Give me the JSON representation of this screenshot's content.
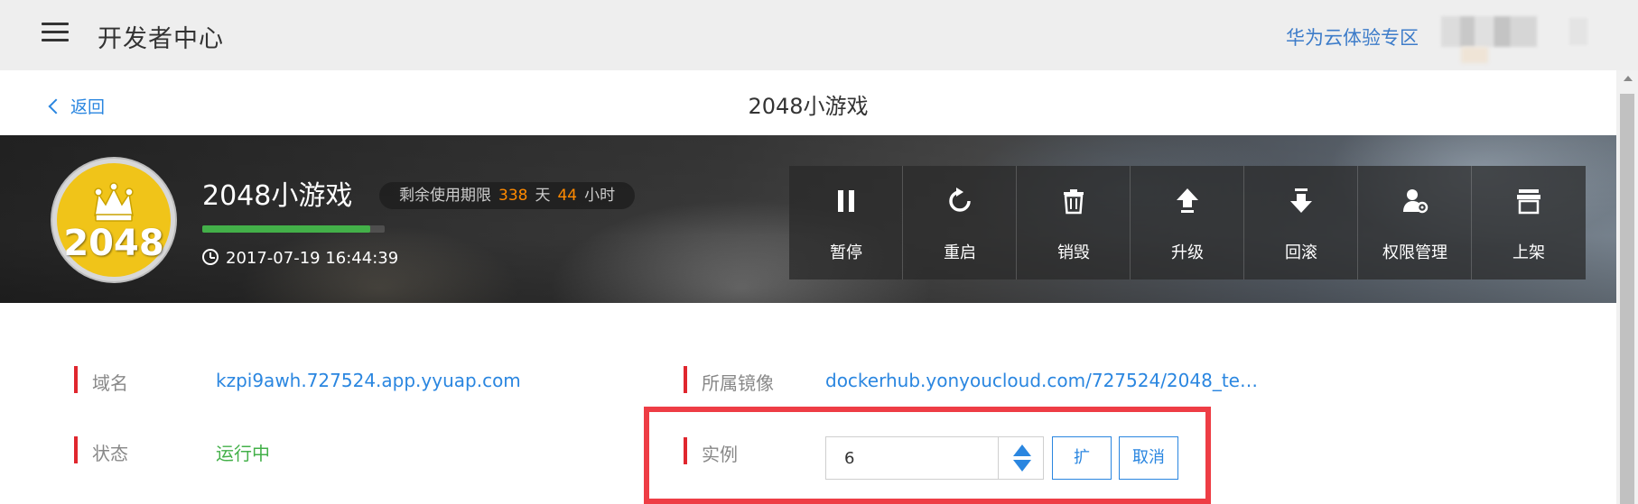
{
  "header": {
    "app_title": "开发者中心",
    "cloud_link": "华为云体验专区"
  },
  "subheader": {
    "back_label": "返回",
    "page_title": "2048小游戏"
  },
  "app": {
    "logo_text": "2048",
    "name": "2048小游戏",
    "expiry_label": "剩余使用期限",
    "days": "338",
    "days_unit": "天",
    "hours": "44",
    "hours_unit": "小时",
    "created_at": "2017-07-19 16:44:39",
    "progress_fraction": 0.92
  },
  "actions": [
    {
      "label": "暂停",
      "icon": "pause-icon"
    },
    {
      "label": "重启",
      "icon": "restart-icon"
    },
    {
      "label": "销毁",
      "icon": "trash-icon"
    },
    {
      "label": "升级",
      "icon": "upgrade-icon"
    },
    {
      "label": "回滚",
      "icon": "rollback-icon"
    },
    {
      "label": "权限管理",
      "icon": "permission-icon"
    },
    {
      "label": "上架",
      "icon": "store-icon"
    }
  ],
  "info": {
    "domain_label": "域名",
    "domain_value": "kzpi9awh.727524.app.yyuap.com",
    "image_label": "所属镜像",
    "image_value": "dockerhub.yonyoucloud.com/727524/2048_te…",
    "status_label": "状态",
    "status_value": "运行中",
    "instance_label": "实例",
    "instance_value": "6",
    "scale_button": "扩",
    "cancel_button": "取消"
  },
  "colors": {
    "accent": "#2a86e0",
    "highlight": "#ee3d45",
    "status_green": "#43b049",
    "counter_orange": "#ff8a00"
  }
}
